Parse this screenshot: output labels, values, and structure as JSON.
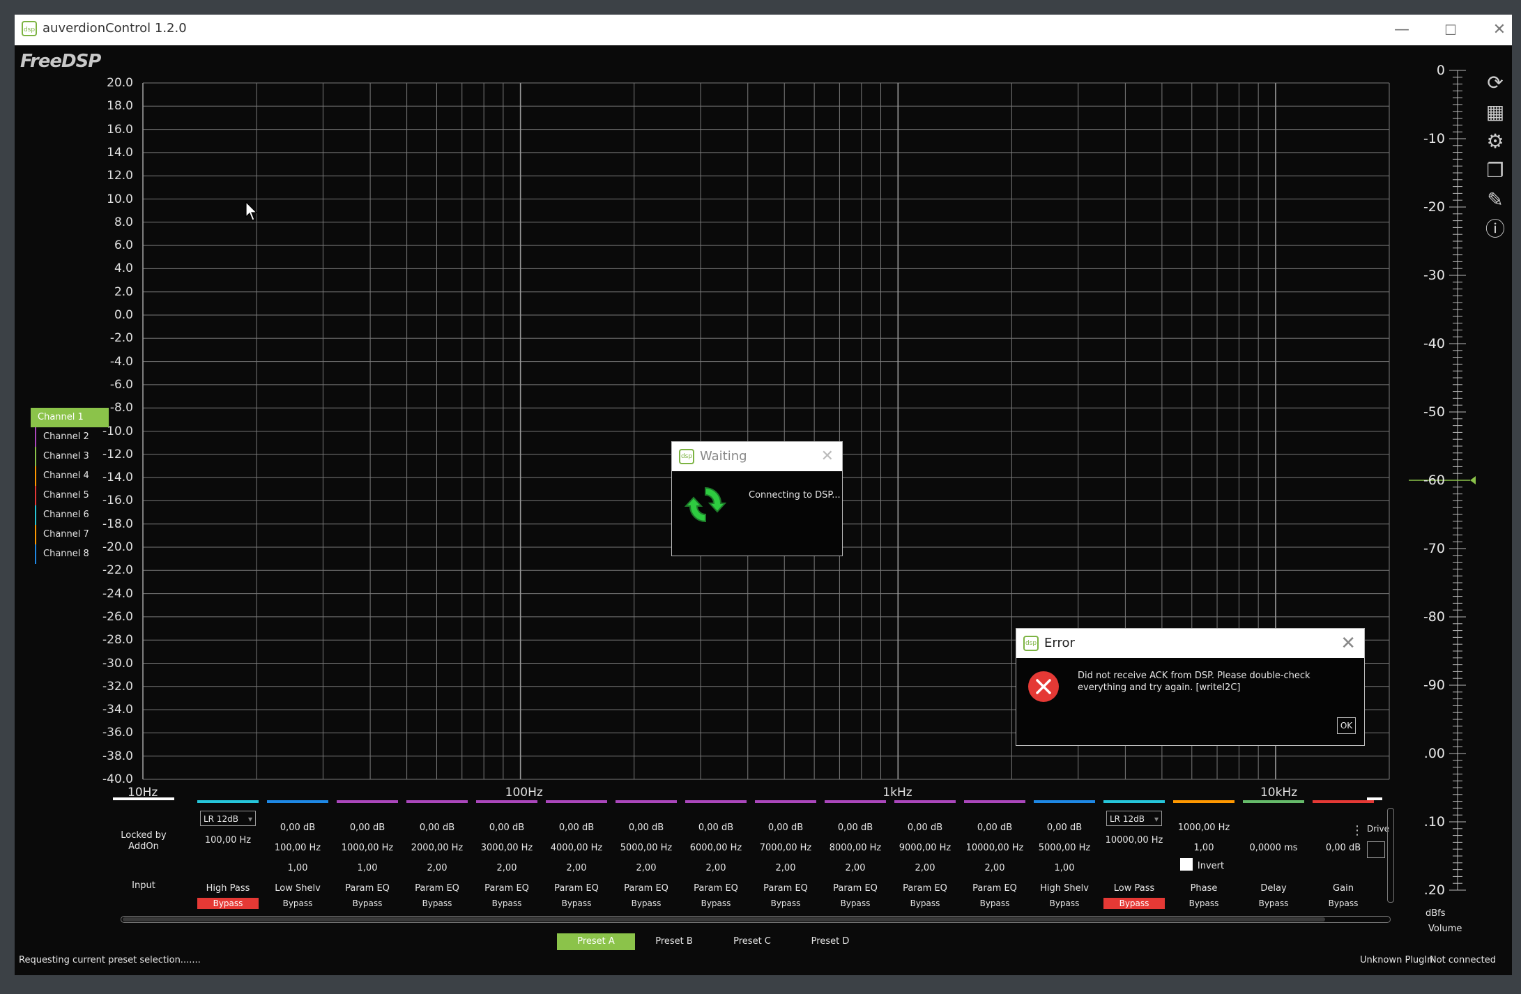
{
  "window": {
    "title": "auverdionControl 1.2.0",
    "minimize": "—",
    "maximize": "☐",
    "close": "✕",
    "logo": "FreeDSP"
  },
  "chart": {
    "ylabels": [
      "20.0",
      "18.0",
      "16.0",
      "14.0",
      "12.0",
      "10.0",
      "8.0",
      "6.0",
      "4.0",
      "2.0",
      "0.0",
      "-2.0",
      "-4.0",
      "-6.0",
      "-8.0",
      "-10.0",
      "-12.0",
      "-14.0",
      "-16.0",
      "-18.0",
      "-20.0",
      "-22.0",
      "-24.0",
      "-26.0",
      "-28.0",
      "-30.0",
      "-32.0",
      "-34.0",
      "-36.0",
      "-38.0",
      "-40.0"
    ],
    "xlabels": [
      "10Hz",
      "100Hz",
      "1kHz",
      "10kHz"
    ]
  },
  "chart_data": {
    "type": "line",
    "title": "",
    "xlabel": "",
    "ylabel": "",
    "xscale": "log",
    "xlim": [
      10,
      20000
    ],
    "ylim": [
      -40,
      20
    ],
    "x_ticks": [
      "10Hz",
      "100Hz",
      "1kHz",
      "10kHz"
    ],
    "y_ticks": [
      20,
      18,
      16,
      14,
      12,
      10,
      8,
      6,
      4,
      2,
      0,
      -2,
      -4,
      -6,
      -8,
      -10,
      -12,
      -14,
      -16,
      -18,
      -20,
      -22,
      -24,
      -26,
      -28,
      -30,
      -32,
      -34,
      -36,
      -38,
      -40
    ],
    "grid": true,
    "series": []
  },
  "channels": [
    {
      "label": "Channel 1",
      "color": "#8bc34a"
    },
    {
      "label": "Channel 2",
      "color": "#ab47bc"
    },
    {
      "label": "Channel 3",
      "color": "#8bc34a"
    },
    {
      "label": "Channel 4",
      "color": "#ff9800"
    },
    {
      "label": "Channel 5",
      "color": "#e53935"
    },
    {
      "label": "Channel 6",
      "color": "#26c6da"
    },
    {
      "label": "Channel 7",
      "color": "#ff9800"
    },
    {
      "label": "Channel 8",
      "color": "#1e88e5"
    }
  ],
  "volume": {
    "labels": [
      "0",
      "-10",
      "-20",
      "-30",
      "-40",
      "-50",
      "-60",
      "-70",
      "-80",
      "-90",
      ".00",
      ".10",
      ".20"
    ],
    "unit": "dBfs",
    "title": "Volume",
    "level_db": -60
  },
  "tools": [
    "refresh-icon",
    "chip-icon",
    "gear-icon",
    "windows-icon",
    "edit-icon",
    "info-icon"
  ],
  "input": {
    "line1": "Locked by",
    "line2": "AddOn",
    "label": "Input"
  },
  "filters": [
    {
      "color": "#26c6da",
      "dropdown": "LR 12dB",
      "v1": "100,00 Hz",
      "name": "High Pass",
      "bypass": "Bypass",
      "red": true
    },
    {
      "color": "#1e88e5",
      "v0": "0,00 dB",
      "v1": "100,00 Hz",
      "v2": "1,00",
      "name": "Low Shelv",
      "bypass": "Bypass"
    },
    {
      "color": "#ab47bc",
      "v0": "0,00 dB",
      "v1": "1000,00 Hz",
      "v2": "1,00",
      "name": "Param EQ",
      "bypass": "Bypass"
    },
    {
      "color": "#ab47bc",
      "v0": "0,00 dB",
      "v1": "2000,00 Hz",
      "v2": "2,00",
      "name": "Param EQ",
      "bypass": "Bypass"
    },
    {
      "color": "#ab47bc",
      "v0": "0,00 dB",
      "v1": "3000,00 Hz",
      "v2": "2,00",
      "name": "Param EQ",
      "bypass": "Bypass"
    },
    {
      "color": "#ab47bc",
      "v0": "0,00 dB",
      "v1": "4000,00 Hz",
      "v2": "2,00",
      "name": "Param EQ",
      "bypass": "Bypass"
    },
    {
      "color": "#ab47bc",
      "v0": "0,00 dB",
      "v1": "5000,00 Hz",
      "v2": "2,00",
      "name": "Param EQ",
      "bypass": "Bypass"
    },
    {
      "color": "#ab47bc",
      "v0": "0,00 dB",
      "v1": "6000,00 Hz",
      "v2": "2,00",
      "name": "Param EQ",
      "bypass": "Bypass"
    },
    {
      "color": "#ab47bc",
      "v0": "0,00 dB",
      "v1": "7000,00 Hz",
      "v2": "2,00",
      "name": "Param EQ",
      "bypass": "Bypass"
    },
    {
      "color": "#ab47bc",
      "v0": "0,00 dB",
      "v1": "8000,00 Hz",
      "v2": "2,00",
      "name": "Param EQ",
      "bypass": "Bypass"
    },
    {
      "color": "#ab47bc",
      "v0": "0,00 dB",
      "v1": "9000,00 Hz",
      "v2": "2,00",
      "name": "Param EQ",
      "bypass": "Bypass"
    },
    {
      "color": "#ab47bc",
      "v0": "0,00 dB",
      "v1": "10000,00 Hz",
      "v2": "2,00",
      "name": "Param EQ",
      "bypass": "Bypass"
    },
    {
      "color": "#1e88e5",
      "v0": "0,00 dB",
      "v1": "5000,00 Hz",
      "v2": "1,00",
      "name": "High Shelv",
      "bypass": "Bypass"
    },
    {
      "color": "#26c6da",
      "dropdown": "LR 12dB",
      "v1": "10000,00 Hz",
      "name": "Low Pass",
      "bypass": "Bypass",
      "red": true
    },
    {
      "color": "#ff9800",
      "v0": "1000,00 Hz",
      "v1": "1,00",
      "invert": "Invert",
      "name": "Phase",
      "bypass": "Bypass"
    },
    {
      "color": "#66bb6a",
      "v0": "",
      "v1": "0,0000 ms",
      "name": "Delay",
      "bypass": "Bypass"
    },
    {
      "color": "#e53935",
      "v0": "",
      "v1": "0,00 dB",
      "name": "Gain",
      "bypass": "Bypass"
    }
  ],
  "driver_label": "Drive",
  "presets": [
    "Preset A",
    "Preset B",
    "Preset C",
    "Preset D"
  ],
  "status": {
    "left": "Requesting current preset selection.......",
    "plugin": "Unknown PlugIn",
    "connection": "Not connected"
  },
  "waiting_dialog": {
    "title": "Waiting",
    "message": "Connecting to DSP...",
    "close": "✕"
  },
  "error_dialog": {
    "title": "Error",
    "message": "Did not receive ACK from DSP. Please double-check everything and try again. [writeI2C]",
    "ok": "OK",
    "close": "✕"
  },
  "colors": {
    "accent": "#8bc34a",
    "bypass_active": "#e53935",
    "background": "#0a0a0a"
  }
}
